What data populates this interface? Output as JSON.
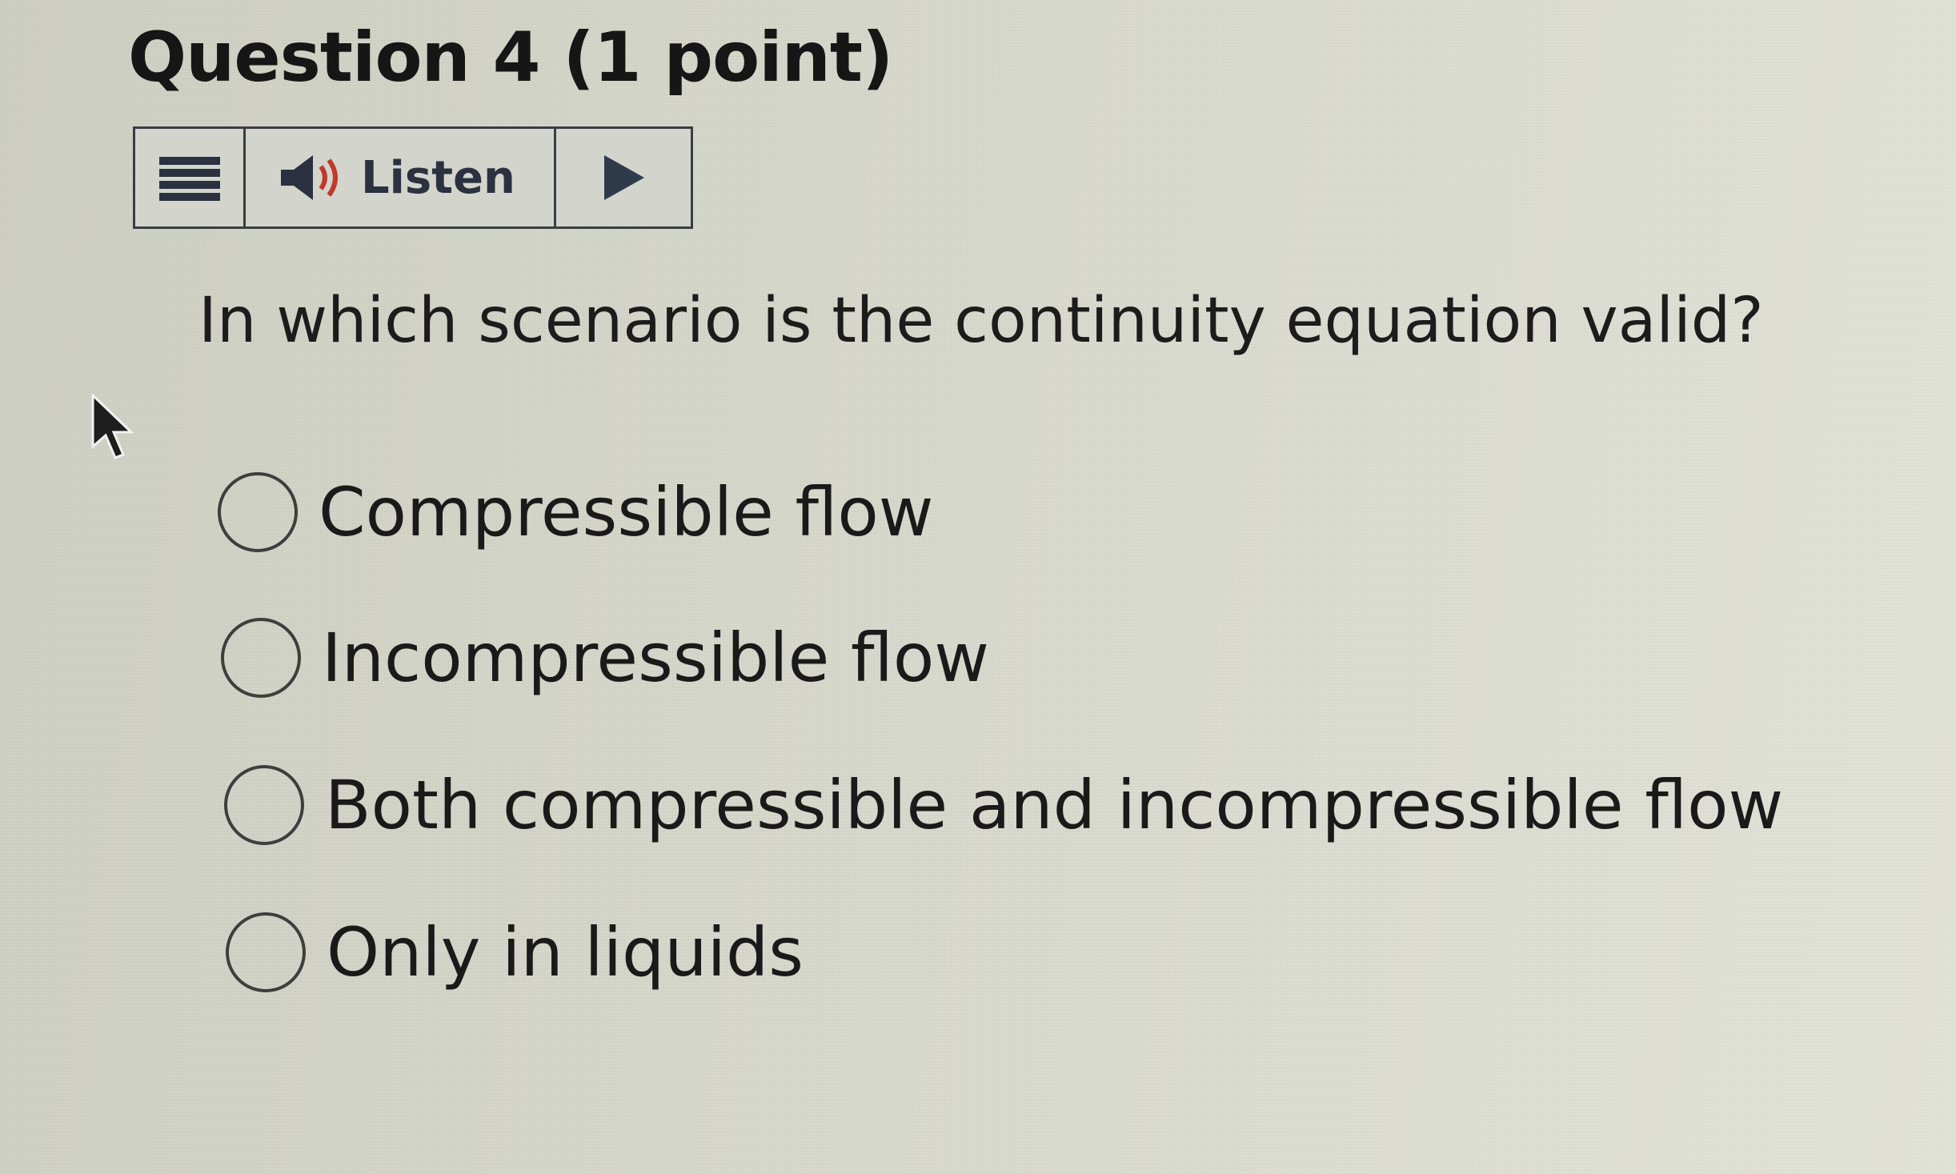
{
  "question": {
    "title": "Question 4 (1 point)",
    "prompt": "In which scenario is the continuity equation valid?",
    "options": [
      {
        "label": "Compressible flow",
        "selected": false
      },
      {
        "label": "Incompressible flow",
        "selected": false
      },
      {
        "label": "Both compressible and incompressible flow",
        "selected": false
      },
      {
        "label": "Only in liquids",
        "selected": false
      }
    ]
  },
  "toolbar": {
    "menu_icon": "hamburger-menu-icon",
    "speaker_icon": "speaker-icon",
    "listen_label": "Listen",
    "play_icon": "play-icon"
  },
  "colors": {
    "background": "#d6d7cb",
    "text": "#1a1a1a",
    "toolbar_border": "#3a3d44",
    "listen_text": "#2b3140",
    "speaker_accent": "#c0392b",
    "play": "#2f3a4a"
  }
}
